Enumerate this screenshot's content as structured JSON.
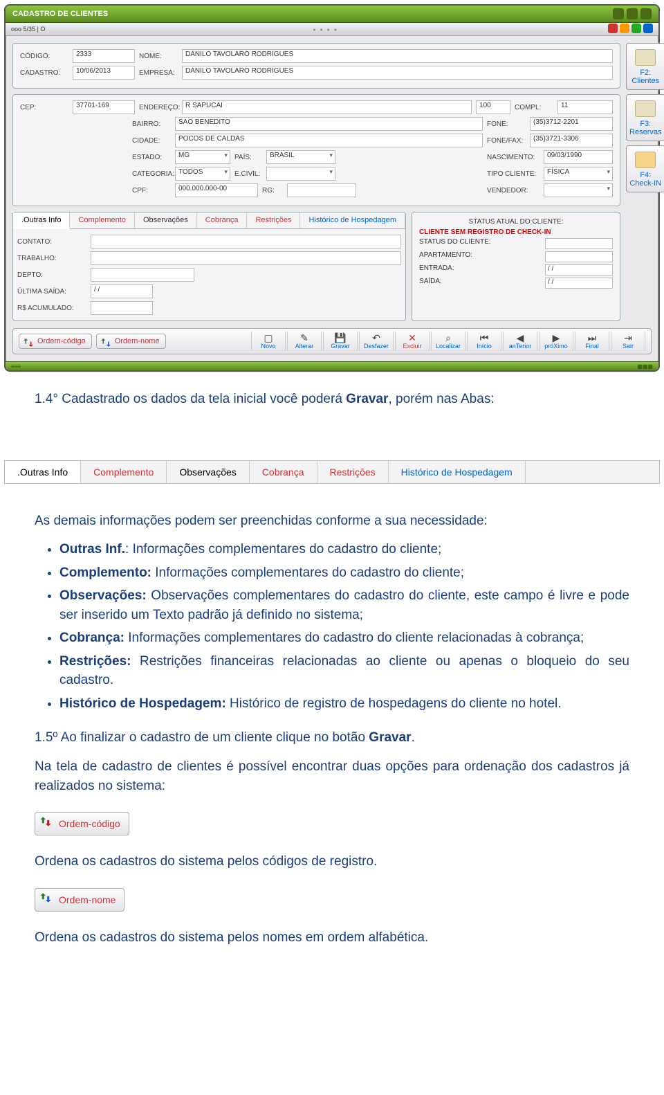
{
  "window": {
    "title": "CADASTRO DE CLIENTES",
    "menubar_left": "ooo 5/35 | O"
  },
  "side_buttons": [
    {
      "label": "F2: Clientes"
    },
    {
      "label": "F3: Reservas"
    },
    {
      "label": "F4: Check-IN"
    }
  ],
  "form": {
    "codigo_label": "CÓDIGO:",
    "codigo": "2333",
    "nome_label": "NOME:",
    "nome": "DANILO TAVOLARO RODRIGUES",
    "cadastro_label": "CADASTRO:",
    "cadastro": "10/06/2013",
    "empresa_label": "EMPRESA:",
    "empresa": "DANILO TAVOLARO RODRIGUES",
    "cep_label": "CEP:",
    "cep": "37701-169",
    "endereco_label": "ENDEREÇO:",
    "endereco": "R SAPUCAI",
    "numero": "100",
    "compl_label": "COMPL:",
    "compl": "11",
    "bairro_label": "BAIRRO:",
    "bairro": "SAO BENEDITO",
    "fone_label": "FONE:",
    "fone": "(35)3712-2201",
    "cidade_label": "CIDADE:",
    "cidade": "POCOS DE CALDAS",
    "fonefax_label": "FONE/FAX:",
    "fonefax": "(35)3721-3306",
    "estado_label": "ESTADO:",
    "estado": "MG",
    "pais_label": "PAÍS:",
    "pais": "BRASIL",
    "nascimento_label": "NASCIMENTO:",
    "nascimento": "09/03/1990",
    "categoria_label": "CATEGORIA:",
    "categoria": "TODOS",
    "ecivil_label": "E.CIVIL:",
    "ecivil": "",
    "tipocliente_label": "TIPO CLIENTE:",
    "tipocliente": "FÍSICA",
    "cpf_label": "CPF:",
    "cpf": "000.000.000-00",
    "rg_label": "RG:",
    "rg": "",
    "vendedor_label": "VENDEDOR:",
    "vendedor": ""
  },
  "tabs_panel": {
    "tabs": [
      ".Outras Info",
      "Complemento",
      "Observações",
      "Cobrança",
      "Restrições",
      "Histórico de Hospedagem"
    ],
    "contato_label": "CONTATO:",
    "trabalho_label": "TRABALHO:",
    "depto_label": "DEPTO:",
    "ultima_label": "ÚLTIMA SAÍDA:",
    "ultima_value": "/ /",
    "rs_label": "R$ ACUMULADO:"
  },
  "status": {
    "heading": "STATUS ATUAL DO CLIENTE:",
    "warn": "CLIENTE SEM REGISTRO DE CHECK-IN",
    "status_label": "STATUS DO CLIENTE:",
    "apto_label": "APARTAMENTO:",
    "entrada_label": "ENTRADA:",
    "entrada": "/ /",
    "saida_label": "SAÍDA:",
    "saida": "/ /"
  },
  "toolbar": {
    "ordem_codigo": "Ordem-código",
    "ordem_nome": "Ordem-nome",
    "nav": [
      "Novo",
      "Alterar",
      "Gravar",
      "Desfazer",
      "Excluir",
      "Localizar",
      "Início",
      "anTerior",
      "próXimo",
      "Final",
      "Sair"
    ]
  },
  "tabs_strip": [
    ".Outras Info",
    "Complemento",
    "Observações",
    "Cobrança",
    "Restrições",
    "Histórico de Hospedagem"
  ],
  "doc": {
    "p1_a": "1.4° Cadastrado os dados da tela inicial você poderá",
    "p1_b": "Gravar",
    "p1_c": ", porém nas Abas:",
    "p2": "As demais informações podem ser preenchidas conforme a sua necessidade:",
    "li1_a": "Outras Inf.",
    "li1_b": ": Informações complementares do cadastro do cliente;",
    "li2_a": "Complemento:",
    "li2_b": " Informações complementares do cadastro do cliente;",
    "li3_a": "Observações:",
    "li3_b": " Observações complementares do cadastro do cliente, este campo é livre e pode ser inserido um Texto padrão já definido no sistema;",
    "li4_a": "Cobrança:",
    "li4_b": " Informações complementares do cadastro do cliente relacionadas à cobrança;",
    "li5_a": "Restrições:",
    "li5_b": " Restrições financeiras relacionadas ao cliente ou apenas o bloqueio do seu cadastro.",
    "li6_a": "Histórico de Hospedagem:",
    "li6_b": " Histórico de registro de hospedagens do cliente no hotel.",
    "p3_a": "1.5º Ao finalizar o cadastro de um cliente clique no botão ",
    "p3_b": "Gravar",
    "p3_c": ".",
    "p4": "Na tela de cadastro de clientes é possível encontrar duas opções para ordenação dos cadastros já realizados no sistema:",
    "btn1": "Ordem-código",
    "p5": "Ordena os cadastros do sistema pelos códigos de registro.",
    "btn2": "Ordem-nome",
    "p6": "Ordena os cadastros do sistema pelos nomes em ordem alfabética."
  }
}
